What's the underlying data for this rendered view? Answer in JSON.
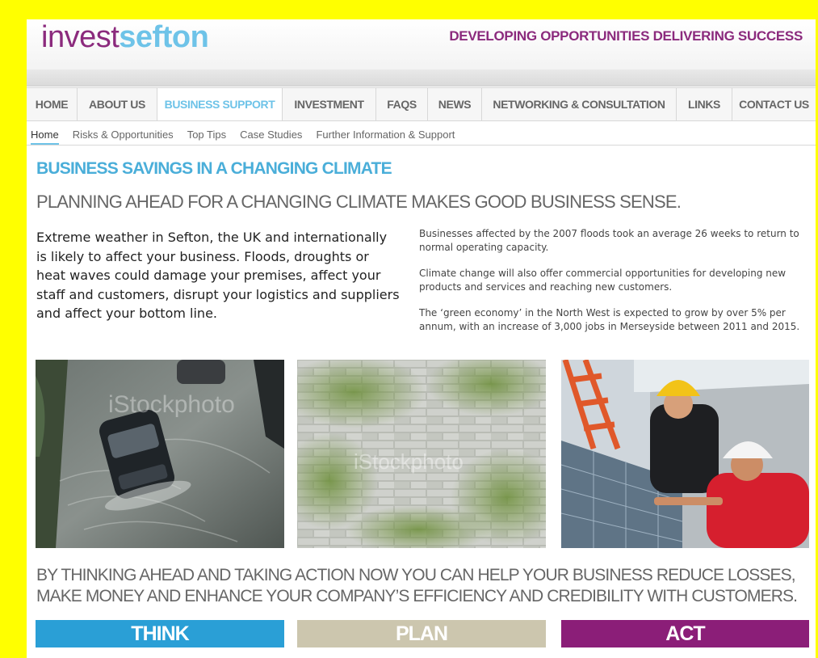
{
  "header": {
    "logo_part1": "invest",
    "logo_part2": "sefton",
    "tagline": "DEVELOPING OPPORTUNITIES DELIVERING SUCCESS"
  },
  "main_nav": {
    "items": [
      {
        "label": "HOME"
      },
      {
        "label": "ABOUT US"
      },
      {
        "label": "BUSINESS SUPPORT",
        "active": true
      },
      {
        "label": "INVESTMENT"
      },
      {
        "label": "FAQS"
      },
      {
        "label": "NEWS"
      },
      {
        "label": "NETWORKING & CONSULTATION"
      },
      {
        "label": "LINKS"
      },
      {
        "label": "CONTACT US"
      }
    ]
  },
  "sub_nav": {
    "items": [
      {
        "label": "Home",
        "active": true
      },
      {
        "label": "Risks & Opportunities"
      },
      {
        "label": "Top Tips"
      },
      {
        "label": "Case Studies"
      },
      {
        "label": "Further Information & Support"
      }
    ]
  },
  "content": {
    "title": "BUSINESS SAVINGS IN A CHANGING CLIMATE",
    "subtitle": "PLANNING AHEAD FOR A CHANGING CLIMATE MAKES GOOD BUSINESS SENSE.",
    "intro": "Extreme weather in Sefton, the UK and internationally is likely to affect your business. Floods, droughts or heat waves could damage your premises, affect your staff and customers, disrupt your logistics and suppliers and affect your bottom line.",
    "facts": [
      "Businesses affected by the 2007 floods took an average 26 weeks to return to normal operating capacity.",
      "Climate change will also offer commercial opportunities for developing new products and services and reaching new customers.",
      "The ‘green economy’ in the North West is expected to grow by over 5% per annum, with an increase of 3,000 jobs in Merseyside between 2011 and 2015."
    ],
    "photos": {
      "watermark": "iStockphoto"
    },
    "callout": "BY THINKING AHEAD AND TAKING ACTION NOW YOU CAN HELP YOUR BUSINESS REDUCE LOSSES, MAKE MONEY AND ENHANCE YOUR COMPANY’S EFFICIENCY AND CREDIBILITY WITH CUSTOMERS."
  },
  "actions": {
    "think": "THINK",
    "plan": "PLAN",
    "act": "ACT"
  },
  "colors": {
    "page_border": "#ffff00",
    "brand_purple": "#8b2a7d",
    "brand_blue": "#6ec3e8",
    "think_bg": "#2a9fd6",
    "plan_bg": "#ccc6ae",
    "act_bg": "#8b1e78"
  }
}
